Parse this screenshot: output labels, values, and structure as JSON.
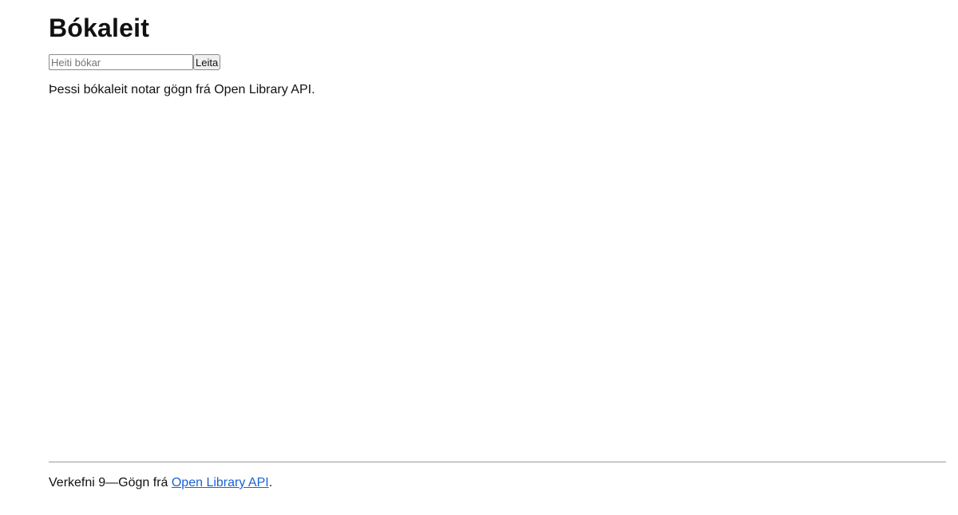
{
  "header": {
    "title": "Bókaleit"
  },
  "search": {
    "placeholder": "Heiti bókar",
    "value": "",
    "button_label": "Leita"
  },
  "main": {
    "intro_text": "Þessi bókaleit notar gögn frá Open Library API."
  },
  "footer": {
    "text_prefix": "Verkefni 9—Gögn frá ",
    "link_text": "Open Library API",
    "text_suffix": "."
  },
  "colors": {
    "link": "#1a62d6",
    "text": "#111111",
    "divider": "#9a9a9a"
  }
}
